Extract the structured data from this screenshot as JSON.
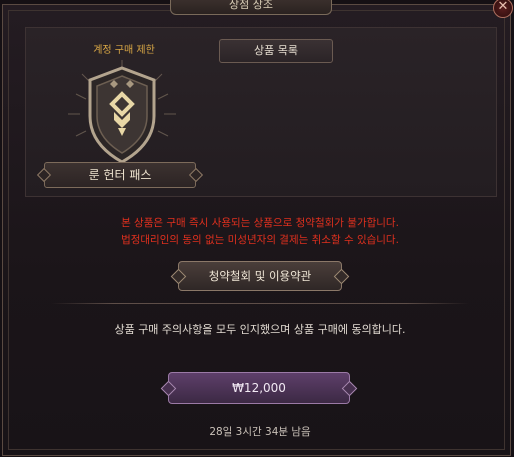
{
  "window": {
    "title": "상점 상조",
    "close_icon": "close-icon"
  },
  "product": {
    "purchase_limit": "계정 구매 제한",
    "name": "룬 헌터 패스",
    "emblem_icon": "rune-shield-emblem-icon"
  },
  "list": {
    "header": "상품 목록"
  },
  "notice": {
    "line1": "본 상품은 구매 즉시 사용되는 상품으로 청약철회가 불가합니다.",
    "line2": "법정대리인의 동의 없는 미성년자의 결제는 취소할 수 있습니다."
  },
  "terms_button": "청약철회 및 이용약관",
  "consent_text": "상품 구매 주의사항을 모두 인지했으며 상품 구매에 동의합니다.",
  "price_button": "₩12,000",
  "time_remaining": "28일 3시간 34분 남음",
  "colors": {
    "warning": "#e0301e",
    "limit": "#d9a745",
    "price_button": "#5e3f6a"
  }
}
